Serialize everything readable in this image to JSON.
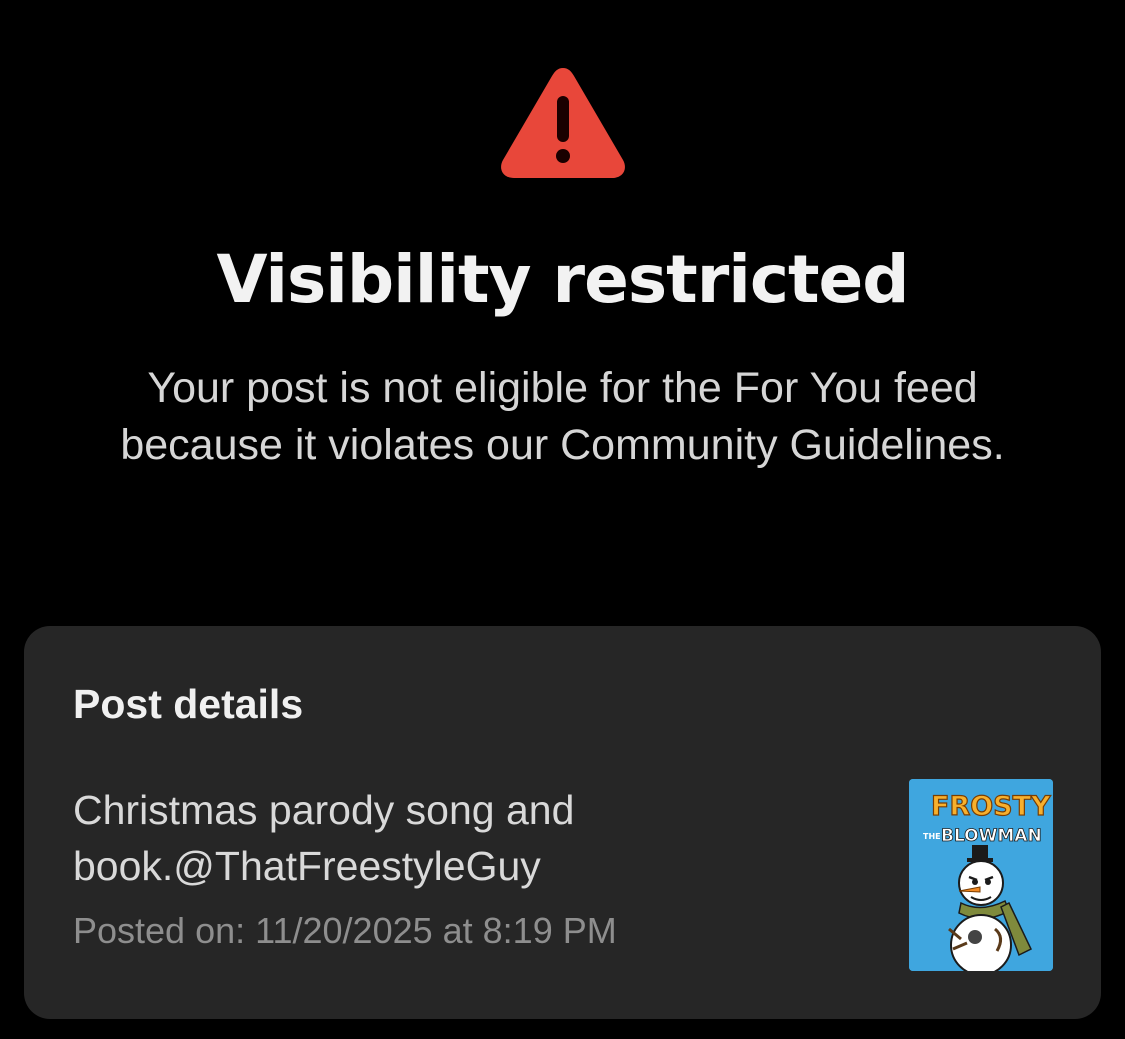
{
  "banner": {
    "icon": "warning-triangle-icon",
    "icon_color": "#e8473a",
    "title": "Visibility restricted",
    "message": "Your post is not eligible for the For You feed because it violates our Community Guidelines."
  },
  "post_details": {
    "heading": "Post details",
    "caption_line1": "Christmas parody song and",
    "caption_line2": "book.@ThatFreestyleGuy",
    "posted_on": "Posted on: 11/20/2025 at 8:19 PM",
    "thumbnail": {
      "title_line1": "FROSTY",
      "title_small": "THE",
      "title_line2": "BLOWMAN",
      "background": "#3fa6df"
    }
  }
}
